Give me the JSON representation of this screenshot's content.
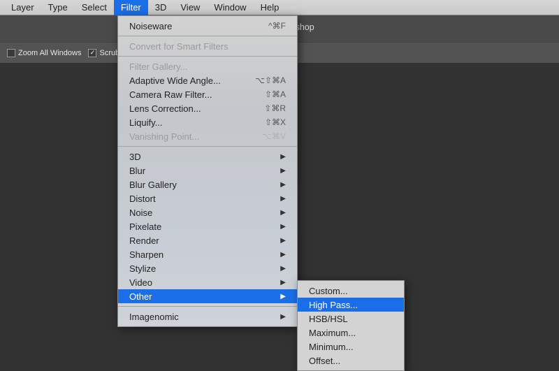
{
  "app_title": "Adobe Photoshop",
  "menubar": {
    "items": [
      "Layer",
      "Type",
      "Select",
      "Filter",
      "3D",
      "View",
      "Window",
      "Help"
    ],
    "active": "Filter"
  },
  "options_row": {
    "zoom_all_windows": {
      "label": "Zoom All Windows",
      "checked": false
    },
    "scrubby_zoom": {
      "label": "Scrubb",
      "checked": true
    }
  },
  "filter_menu": {
    "top": {
      "label": "Noiseware",
      "shortcut": "^⌘F"
    },
    "convert": {
      "label": "Convert for Smart Filters"
    },
    "filter_gallery": {
      "label": "Filter Gallery..."
    },
    "adaptive_wide_angle": {
      "label": "Adaptive Wide Angle...",
      "shortcut": "⌥⇧⌘A"
    },
    "camera_raw": {
      "label": "Camera Raw Filter...",
      "shortcut": "⇧⌘A"
    },
    "lens_correction": {
      "label": "Lens Correction...",
      "shortcut": "⇧⌘R"
    },
    "liquify": {
      "label": "Liquify...",
      "shortcut": "⇧⌘X"
    },
    "vanishing_point": {
      "label": "Vanishing Point...",
      "shortcut": "⌥⌘V"
    },
    "groups": [
      "3D",
      "Blur",
      "Blur Gallery",
      "Distort",
      "Noise",
      "Pixelate",
      "Render",
      "Sharpen",
      "Stylize",
      "Video",
      "Other"
    ],
    "imagenomic": {
      "label": "Imagenomic"
    }
  },
  "other_submenu": {
    "items": [
      "Custom...",
      "High Pass...",
      "HSB/HSL",
      "Maximum...",
      "Minimum...",
      "Offset..."
    ],
    "highlight": "High Pass..."
  }
}
